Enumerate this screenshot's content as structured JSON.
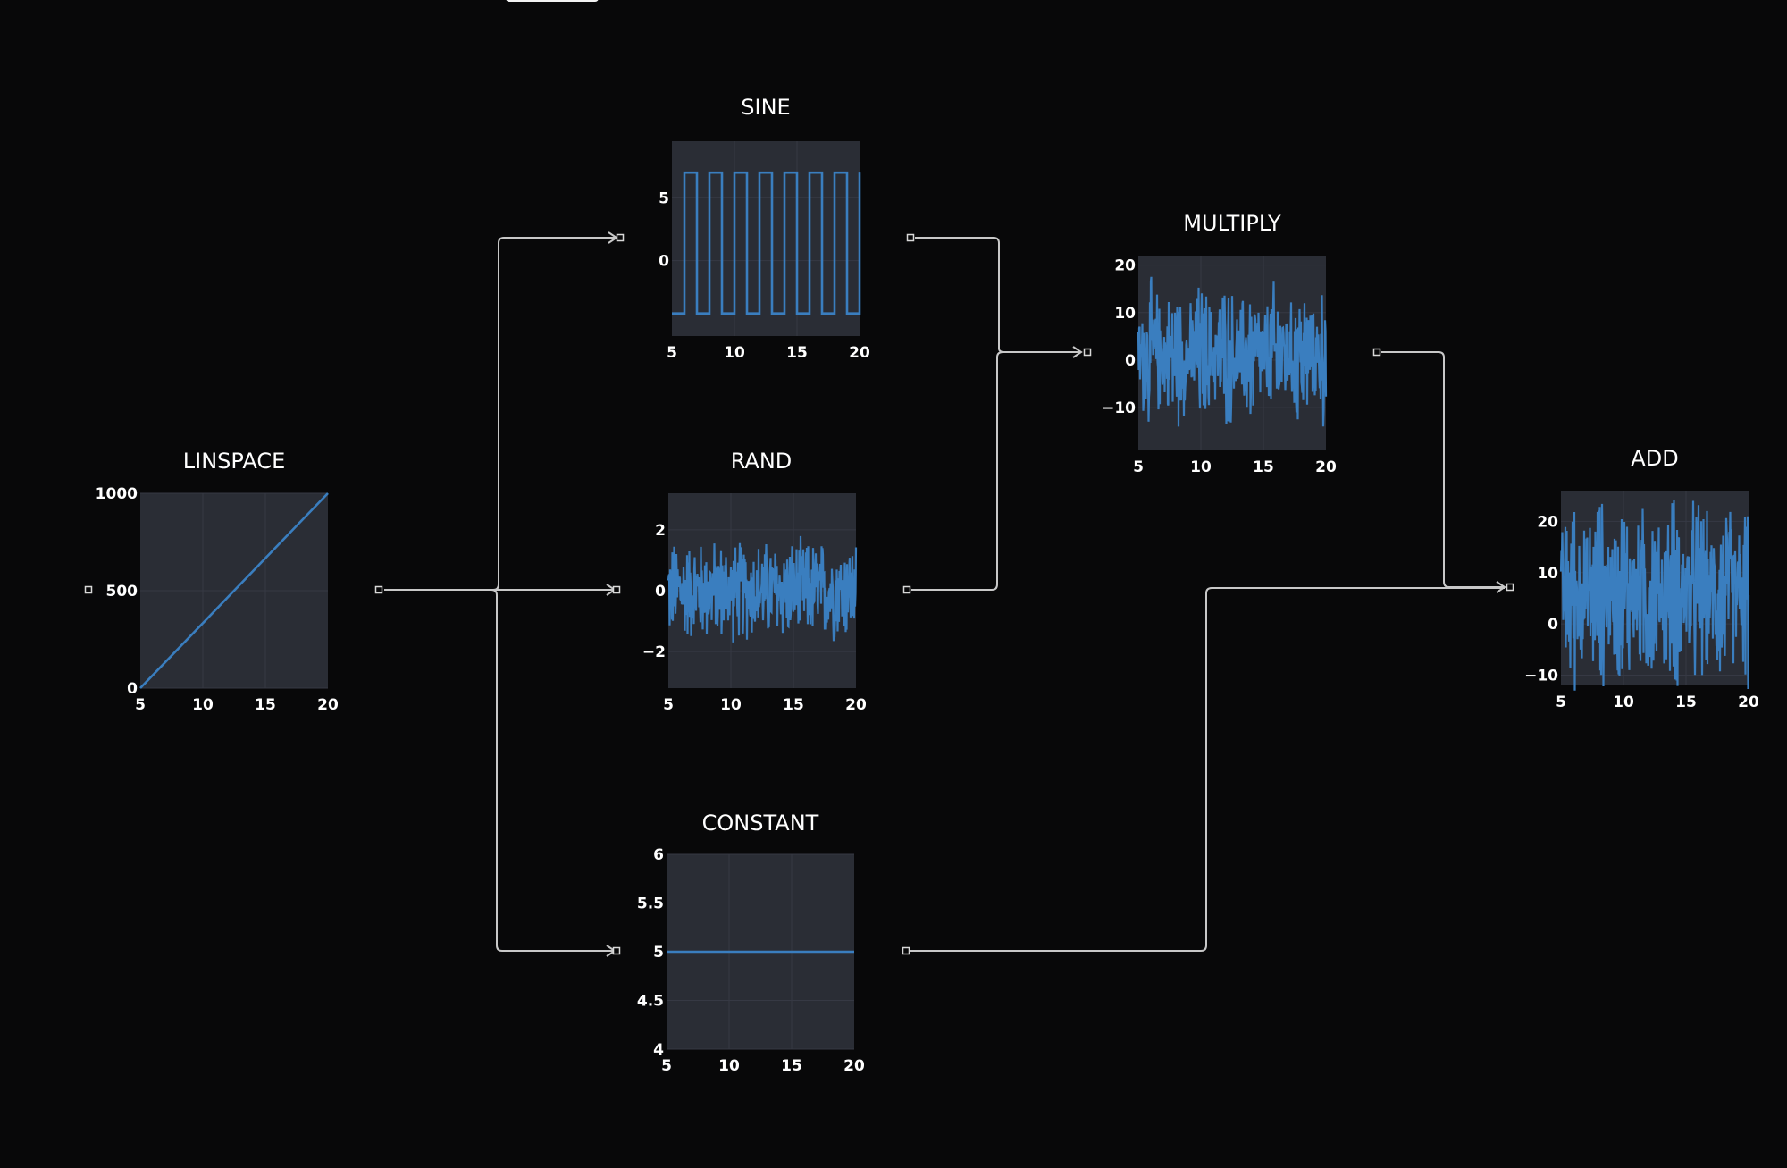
{
  "canvas": {
    "background": "#080809",
    "plot_background": "#2a2d35",
    "line_color": "#3a7ebf",
    "edge_color": "#c8c8c8"
  },
  "nodes": [
    {
      "id": "linspace",
      "title": "LINSPACE"
    },
    {
      "id": "sine",
      "title": "SINE"
    },
    {
      "id": "rand",
      "title": "RAND"
    },
    {
      "id": "constant",
      "title": "CONSTANT"
    },
    {
      "id": "multiply",
      "title": "MULTIPLY"
    },
    {
      "id": "add",
      "title": "ADD"
    }
  ],
  "edges": [
    {
      "from": "linspace",
      "to": "sine"
    },
    {
      "from": "linspace",
      "to": "rand"
    },
    {
      "from": "linspace",
      "to": "constant"
    },
    {
      "from": "sine",
      "to": "multiply"
    },
    {
      "from": "rand",
      "to": "multiply"
    },
    {
      "from": "multiply",
      "to": "add"
    },
    {
      "from": "constant",
      "to": "add"
    }
  ],
  "chart_data": [
    {
      "node": "linspace",
      "type": "line",
      "x": [
        5,
        20
      ],
      "y": [
        0,
        1000
      ],
      "xlim": [
        5,
        20
      ],
      "ylim": [
        0,
        1000
      ],
      "xticks": [
        "5",
        "10",
        "15",
        "20"
      ],
      "yticks": [
        "0",
        "500",
        "1000"
      ]
    },
    {
      "node": "sine",
      "type": "line",
      "style": "square-wave",
      "xlim": [
        5,
        20
      ],
      "ylim": [
        -6,
        9.5
      ],
      "high": 7,
      "low": -4.2,
      "period": 2,
      "first_rise": 6,
      "xticks": [
        "5",
        "10",
        "15",
        "20"
      ],
      "yticks": [
        "0",
        "5"
      ]
    },
    {
      "node": "rand",
      "type": "line",
      "style": "noise",
      "xlim": [
        5,
        20
      ],
      "ylim": [
        -3.2,
        3.2
      ],
      "noise_min": -2.6,
      "noise_max": 2.6,
      "xticks": [
        "5",
        "10",
        "15",
        "20"
      ],
      "yticks": [
        "−2",
        "0",
        "2"
      ]
    },
    {
      "node": "multiply",
      "type": "line",
      "style": "noise",
      "xlim": [
        5,
        20
      ],
      "ylim": [
        -19,
        22
      ],
      "noise_min": -18,
      "noise_max": 20,
      "xticks": [
        "5",
        "10",
        "15",
        "20"
      ],
      "yticks": [
        "−10",
        "0",
        "10",
        "20"
      ]
    },
    {
      "node": "constant",
      "type": "line",
      "x": [
        5,
        20
      ],
      "y": [
        5,
        5
      ],
      "xlim": [
        5,
        20
      ],
      "ylim": [
        4,
        6
      ],
      "xticks": [
        "5",
        "10",
        "15",
        "20"
      ],
      "yticks": [
        "4",
        "4.5",
        "5",
        "5.5",
        "6"
      ]
    },
    {
      "node": "add",
      "type": "line",
      "style": "noise",
      "xlim": [
        5,
        20
      ],
      "ylim": [
        -12,
        26
      ],
      "noise_min": -13,
      "noise_max": 25,
      "xticks": [
        "5",
        "10",
        "15",
        "20"
      ],
      "yticks": [
        "−10",
        "0",
        "10",
        "20"
      ]
    }
  ]
}
